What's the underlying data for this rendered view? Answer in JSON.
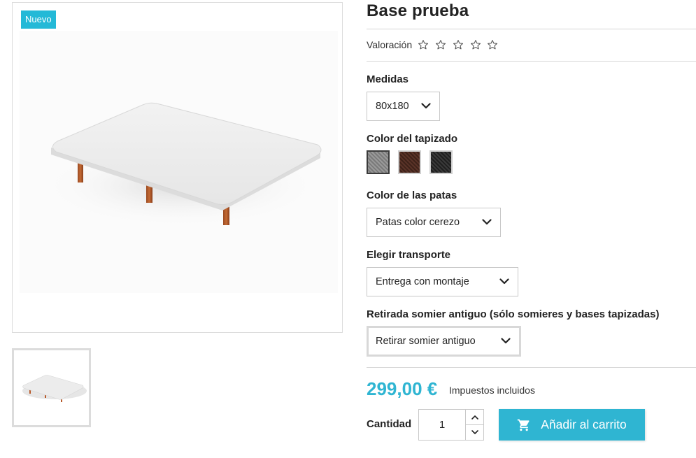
{
  "product": {
    "badge": "Nuevo",
    "title": "Base prueba",
    "rating_label": "Valoración",
    "rating_stars": 0,
    "rating_max": 5
  },
  "options": {
    "medidas": {
      "label": "Medidas",
      "value": "80x180"
    },
    "color_tapizado": {
      "label": "Color del tapizado",
      "swatches": [
        {
          "name": "gris",
          "color": "#8a8a8a",
          "selected": true
        },
        {
          "name": "marron",
          "color": "#4a2a22",
          "selected": false
        },
        {
          "name": "negro",
          "color": "#2a2a2a",
          "selected": false
        }
      ]
    },
    "color_patas": {
      "label": "Color de las patas",
      "value": "Patas color cerezo"
    },
    "transporte": {
      "label": "Elegir transporte",
      "value": "Entrega con montaje"
    },
    "retirada": {
      "label": "Retirada somier antiguo (sólo somieres y bases tapizadas)",
      "value": "Retirar somier antiguo"
    }
  },
  "pricing": {
    "price": "299,00 €",
    "tax_note": "Impuestos incluidos"
  },
  "purchase": {
    "quantity_label": "Cantidad",
    "quantity": "1",
    "add_to_cart": "Añadir al carrito"
  },
  "colors": {
    "accent": "#2fb5d2",
    "badge": "#24b9d7"
  }
}
